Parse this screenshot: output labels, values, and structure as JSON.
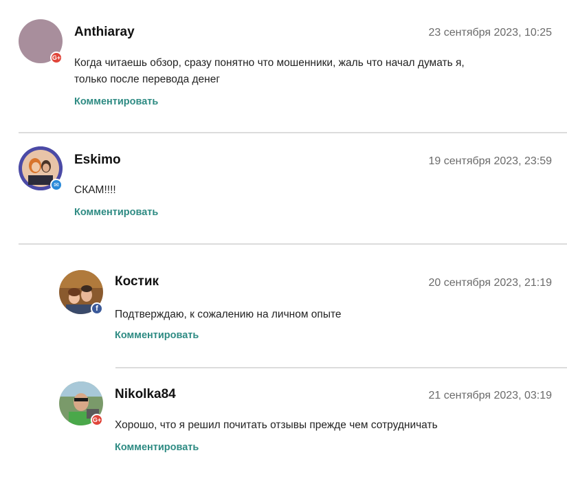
{
  "comments": [
    {
      "author": "Anthiaray",
      "date": "23 сентября 2023, 10:25",
      "text_line1": "Когда читаешь обзор, сразу понятно что мошенники, жаль что начал думать я,",
      "text_line2": "только после перевода денег",
      "reply_label": "Комментировать",
      "badge": "G+",
      "avatar_color": "#a88e9c"
    },
    {
      "author": "Eskimo",
      "date": "19 сентября 2023, 23:59",
      "text_line1": "СКАМ!!!!",
      "reply_label": "Комментировать",
      "badge": "✉"
    },
    {
      "author": "Костик",
      "date": "20 сентября 2023, 21:19",
      "text_line1": "Подтверждаю, к сожалению на личном опыте",
      "reply_label": "Комментировать",
      "badge": "f"
    },
    {
      "author": "Nikolka84",
      "date": "21 сентября 2023, 03:19",
      "text_line1": "Хорошо, что я решил почитать отзывы прежде чем сотрудничать",
      "reply_label": "Комментировать",
      "badge": "G+"
    }
  ],
  "colors": {
    "reply_link": "#2e8b83",
    "date_text": "#6a6a6a",
    "divider": "#dcdcdc",
    "gplus_badge": "#e0453a",
    "mail_badge": "#2b8ad9",
    "facebook_badge": "#3b5a9a"
  }
}
